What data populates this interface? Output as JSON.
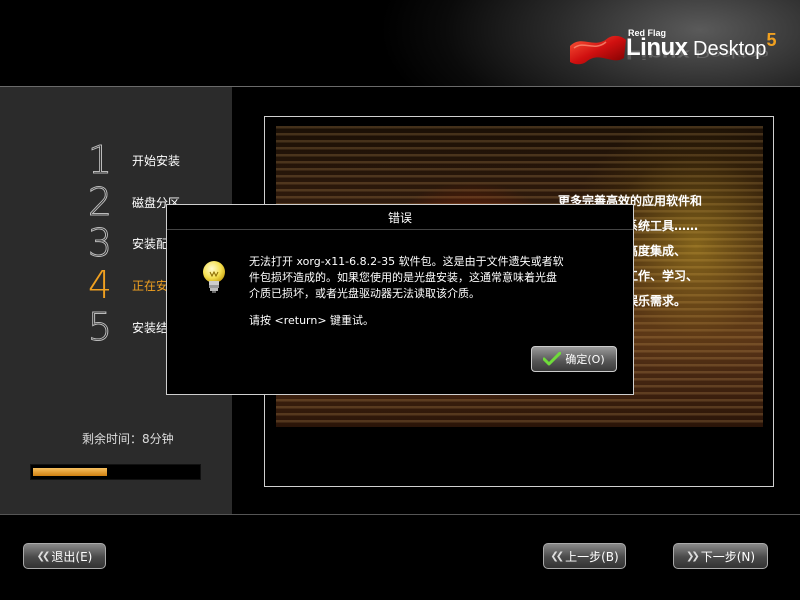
{
  "logo": {
    "brand_small": "Red Flag",
    "brand_bold": "Linux",
    "brand_light": " Desktop",
    "version": "5"
  },
  "steps": [
    {
      "number": "1",
      "label": "开始安装",
      "active": false
    },
    {
      "number": "2",
      "label": "磁盘分区",
      "active": false
    },
    {
      "number": "3",
      "label": "安装配置",
      "active": false
    },
    {
      "number": "4",
      "label": "正在安装",
      "active": true
    },
    {
      "number": "5",
      "label": "安装结束",
      "active": false
    }
  ],
  "remaining_time": "剩余时间：8分钟",
  "progress_fraction": 0.45,
  "banner_lines": [
    "更多完善高效的应用软件和",
    "系统工具……",
    "高度集成、",
    "工作、学习、",
    "娱乐需求。"
  ],
  "dialog": {
    "title": "错误",
    "message_line1": "无法打开  xorg-x11-6.8.2-35 软件包。这是由于文件遗失或者软",
    "message_line2": "件包损坏造成的。如果您使用的是光盘安装，这通常意味着光盘",
    "message_line3": "介质已损坏，或者光盘驱动器无法读取该介质。",
    "retry_text": "请按  <return>  键重试。",
    "ok_label": "确定(O)"
  },
  "buttons": {
    "exit": "退出(E)",
    "back": "上一步(B)",
    "next": "下一步(N)"
  },
  "colors": {
    "accent": "#f0a020",
    "sidebar_bg": "#2b2b2b"
  }
}
